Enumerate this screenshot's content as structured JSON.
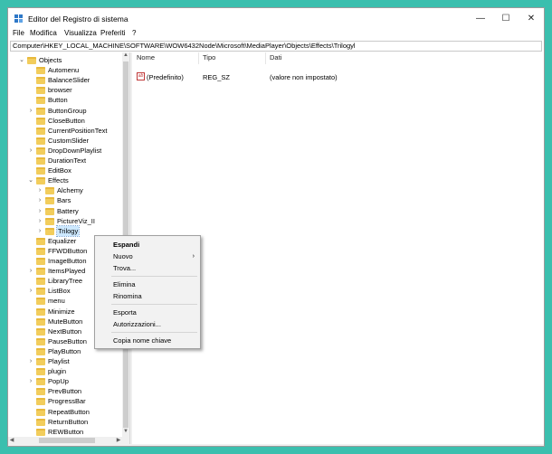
{
  "window": {
    "title": "Editor del Registro di sistema",
    "minimize": "—",
    "maximize": "☐",
    "close": "✕"
  },
  "menubar": [
    "File",
    "Modifica",
    "Visualizza",
    "Preferiti",
    "?"
  ],
  "address": "Computer\\HKEY_LOCAL_MACHINE\\SOFTWARE\\WOW6432Node\\Microsoft\\MediaPlayer\\Objects\\Effects\\Trilogyl",
  "tree": [
    {
      "label": "Objects",
      "level": 0,
      "expander": "expanded"
    },
    {
      "label": "Automenu",
      "level": 1,
      "expander": "none"
    },
    {
      "label": "BalanceSlider",
      "level": 1,
      "expander": "none"
    },
    {
      "label": "browser",
      "level": 1,
      "expander": "none"
    },
    {
      "label": "Button",
      "level": 1,
      "expander": "none"
    },
    {
      "label": "ButtonGroup",
      "level": 1,
      "expander": "collapsed"
    },
    {
      "label": "CloseButton",
      "level": 1,
      "expander": "none"
    },
    {
      "label": "CurrentPositionText",
      "level": 1,
      "expander": "none"
    },
    {
      "label": "CustomSlider",
      "level": 1,
      "expander": "none"
    },
    {
      "label": "DropDownPlaylist",
      "level": 1,
      "expander": "collapsed"
    },
    {
      "label": "DurationText",
      "level": 1,
      "expander": "none"
    },
    {
      "label": "EditBox",
      "level": 1,
      "expander": "none"
    },
    {
      "label": "Effects",
      "level": 1,
      "expander": "expanded"
    },
    {
      "label": "Alchemy",
      "level": 2,
      "expander": "collapsed"
    },
    {
      "label": "Bars",
      "level": 2,
      "expander": "collapsed"
    },
    {
      "label": "Battery",
      "level": 2,
      "expander": "collapsed"
    },
    {
      "label": "PictureViz_II",
      "level": 2,
      "expander": "collapsed"
    },
    {
      "label": "Trilogy",
      "level": 2,
      "expander": "collapsed",
      "selected": true
    },
    {
      "label": "Equalizer",
      "level": 1,
      "expander": "none"
    },
    {
      "label": "FFWDButton",
      "level": 1,
      "expander": "none"
    },
    {
      "label": "ImageButton",
      "level": 1,
      "expander": "none"
    },
    {
      "label": "ItemsPlayed",
      "level": 1,
      "expander": "collapsed"
    },
    {
      "label": "LibraryTree",
      "level": 1,
      "expander": "none"
    },
    {
      "label": "ListBox",
      "level": 1,
      "expander": "collapsed"
    },
    {
      "label": "menu",
      "level": 1,
      "expander": "none"
    },
    {
      "label": "Minimize",
      "level": 1,
      "expander": "none"
    },
    {
      "label": "MuteButton",
      "level": 1,
      "expander": "none"
    },
    {
      "label": "NextButton",
      "level": 1,
      "expander": "none"
    },
    {
      "label": "PauseButton",
      "level": 1,
      "expander": "none"
    },
    {
      "label": "PlayButton",
      "level": 1,
      "expander": "none"
    },
    {
      "label": "Playlist",
      "level": 1,
      "expander": "collapsed"
    },
    {
      "label": "plugin",
      "level": 1,
      "expander": "none"
    },
    {
      "label": "PopUp",
      "level": 1,
      "expander": "collapsed"
    },
    {
      "label": "PrevButton",
      "level": 1,
      "expander": "none"
    },
    {
      "label": "ProgressBar",
      "level": 1,
      "expander": "none"
    },
    {
      "label": "RepeatButton",
      "level": 1,
      "expander": "none"
    },
    {
      "label": "ReturnButton",
      "level": 1,
      "expander": "none"
    },
    {
      "label": "REWButton",
      "level": 1,
      "expander": "none"
    }
  ],
  "list": {
    "columns": {
      "name": "Nome",
      "type": "Tipo",
      "data": "Dati"
    },
    "rows": [
      {
        "icon": "ab",
        "name": "(Predefinito)",
        "type": "REG_SZ",
        "data": "(valore non impostato)"
      }
    ]
  },
  "context_menu": [
    {
      "label": "Espandi",
      "bold": true
    },
    {
      "label": "Nuovo",
      "submenu": true
    },
    {
      "label": "Trova..."
    },
    {
      "separator": true
    },
    {
      "label": "Elimina"
    },
    {
      "label": "Rinomina"
    },
    {
      "separator": true
    },
    {
      "label": "Esporta"
    },
    {
      "label": "Autorizzazioni..."
    },
    {
      "separator": true
    },
    {
      "label": "Copia nome chiave"
    }
  ],
  "colors": {
    "background": "#3bbfae",
    "folder": "#f2cd5c",
    "selection": "#cce8ff"
  }
}
